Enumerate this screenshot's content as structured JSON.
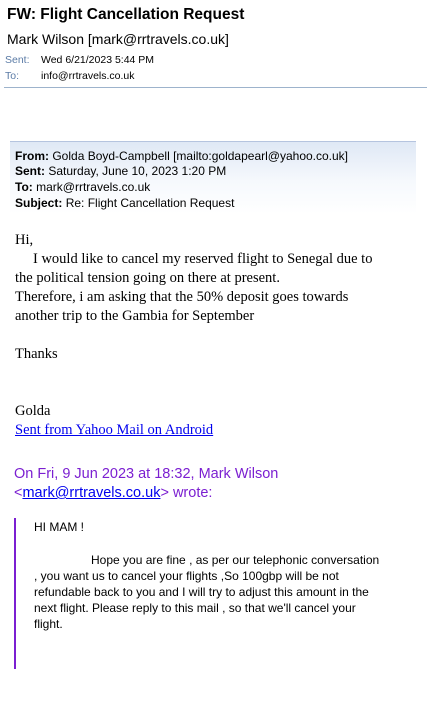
{
  "header": {
    "subject": "FW: Flight Cancellation Request",
    "sender": "Mark Wilson [mark@rrtravels.co.uk]",
    "sent_label": "Sent:",
    "sent_value": "Wed 6/21/2023 5:44 PM",
    "to_label": "To:",
    "to_value": "info@rrtravels.co.uk"
  },
  "forwarded": {
    "from_label": "From:",
    "from_value": "Golda Boyd-Campbell [mailto:goldapearl@yahoo.co.uk]",
    "sent_label": "Sent:",
    "sent_value": "Saturday, June 10, 2023 1:20 PM",
    "to_label": "To:",
    "to_value": "mark@rrtravels.co.uk",
    "subject_label": "Subject:",
    "subject_value": "Re: Flight Cancellation Request"
  },
  "body": {
    "greeting": "Hi,",
    "line1": "I would  like to cancel my reserved flight to Senegal due to",
    "line2": "the political tension going on there at present.",
    "line3": "Therefore, i am asking that  the 50% deposit goes towards",
    "line4": "another trip to the Gambia for September",
    "thanks": "Thanks",
    "signature": "Golda",
    "mobile_link": "Sent from Yahoo Mail on Android"
  },
  "reply_header": {
    "line1": "On Fri, 9 Jun 2023 at 18:32, Mark Wilson",
    "open": "<",
    "email": "mark@rrtravels.co.uk",
    "close": "> wrote:"
  },
  "quoted": {
    "greeting": "HI MAM !",
    "line1": "Hope you are fine , as per our telephonic conversation",
    "line2": ", you want us to cancel your flights ,So 100gbp will be not",
    "line3": "refundable back to you and I will try to adjust this amount in the",
    "line4": "next flight. Please reply to this mail , so that we'll cancel your",
    "line5": "flight."
  }
}
